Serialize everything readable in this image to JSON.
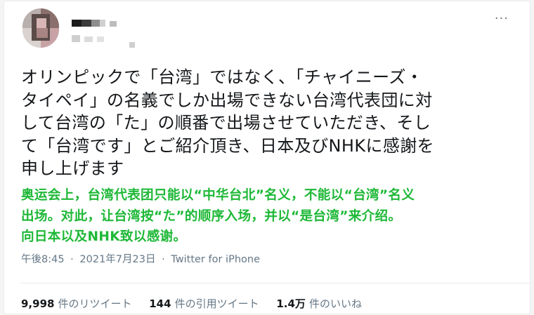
{
  "tweet": {
    "more_label": "···",
    "text": "オリンピックで「台湾」ではなく、「チャイニーズ・\nタイペイ」の名義でしか出場できない台湾代表団に対\nして台湾の「た」の順番で出場させていただき、そし\nて「台湾です」とご紹介頂き、日本及びNHKに感謝を\n申し上げます",
    "translation": "奥运会上，台湾代表团只能以“中华台北”名义，不能以“台湾”名义\n出场。对此，让台湾按“た”的顺序入场，并以“是台湾”来介绍。\n向日本以及NHK致以感谢。",
    "time": "午後8:45",
    "date": "2021年7月23日",
    "separator": "·",
    "source": "Twitter for iPhone"
  },
  "stats": {
    "retweets_count": "9,998",
    "retweets_label": "件のリツイート",
    "quotes_count": "144",
    "quotes_label": "件の引用ツイート",
    "likes_count": "1.4万",
    "likes_label": "件のいいね"
  },
  "colors": {
    "text": "#14171a",
    "meta": "#657786",
    "translation": "#1eb837",
    "divider": "#e6ecf0"
  }
}
